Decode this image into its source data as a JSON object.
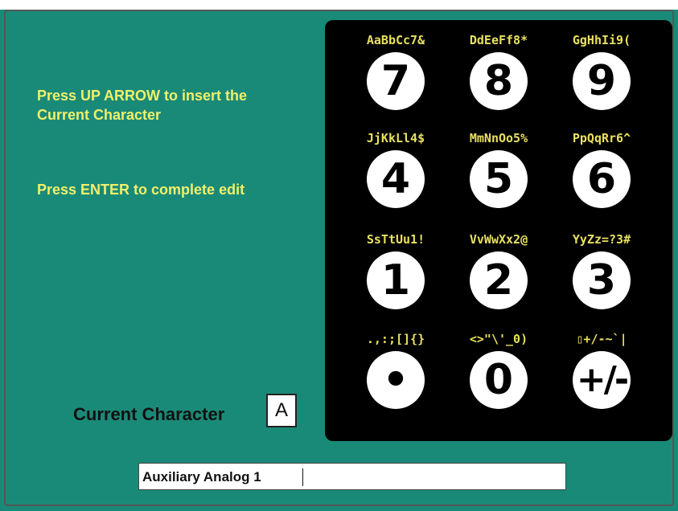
{
  "header": {
    "title_fragment": "/"
  },
  "instructions": {
    "line1": "Press UP ARROW to insert the  Current Character",
    "line2": "Press ENTER to complete edit"
  },
  "current_character": {
    "label": "Current Character",
    "value": "A"
  },
  "keypad": {
    "keys": [
      {
        "chars": "AaBbCc7&",
        "digit": "7"
      },
      {
        "chars": "DdEeFf8*",
        "digit": "8"
      },
      {
        "chars": "GgHhIi9(",
        "digit": "9"
      },
      {
        "chars": "JjKkLl4$",
        "digit": "4"
      },
      {
        "chars": "MmNnOo5%",
        "digit": "5"
      },
      {
        "chars": "PpQqRr6^",
        "digit": "6"
      },
      {
        "chars": "SsTtUu1!",
        "digit": "1"
      },
      {
        "chars": "VvWwXx2@",
        "digit": "2"
      },
      {
        "chars": "YyZz=?3#",
        "digit": "3"
      },
      {
        "chars": ".,:;[]{}",
        "digit": "•"
      },
      {
        "chars": "<>\"\\'_0)",
        "digit": "0"
      },
      {
        "chars": "▯+/-~`|",
        "digit": "+/-"
      }
    ]
  },
  "edit_field": {
    "value": "Auxiliary Analog 1"
  },
  "colors": {
    "background": "#1a8a78",
    "accent_text": "#f0f06a",
    "keypad_bg": "#000000"
  }
}
